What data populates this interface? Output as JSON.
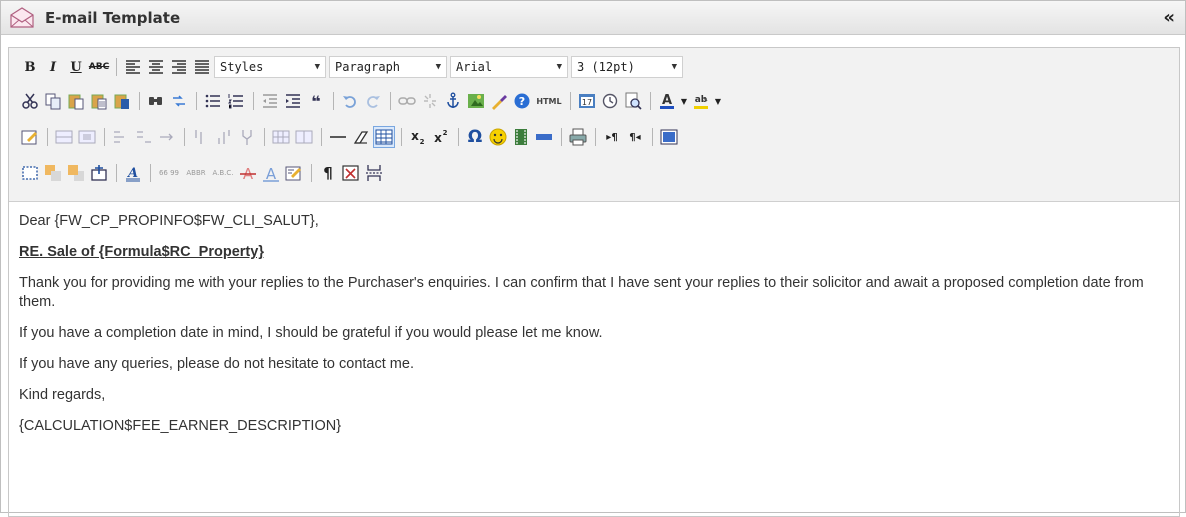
{
  "window": {
    "title": "E-mail Template",
    "collapse_label": "«",
    "icon": "envelope-icon"
  },
  "toolbar": {
    "bold": "B",
    "italic": "I",
    "underline": "U",
    "strike": "ABC",
    "styles": {
      "value": "Styles",
      "options": [
        "Styles"
      ]
    },
    "paragraph": {
      "value": "Paragraph",
      "options": [
        "Paragraph"
      ]
    },
    "font": {
      "value": "Arial",
      "options": [
        "Arial"
      ]
    },
    "size": {
      "value": "3 (12pt)",
      "options": [
        "3 (12pt)"
      ]
    },
    "html_label": "HTML",
    "omega": "Ω",
    "pilcrow": "¶",
    "abbr_label": "ABBR",
    "acronym_label": "A.B.C.",
    "cite_label": "66 99",
    "ltr": "▸¶",
    "rtl": "¶◂"
  },
  "colors": {
    "title_bg": "#e8e8e8",
    "toolbar_bg": "#f2f2f2",
    "text": "#333333",
    "accent_blue": "#1f5fb3",
    "accent_red": "#cc2222",
    "accent_green": "#2e8b2e"
  },
  "content": {
    "salutation": "Dear {FW_CP_PROPINFO$FW_CLI_SALUT},",
    "subject": "RE. Sale of {Formula$RC_Property}",
    "para1": "Thank you for providing me with your replies to the Purchaser's enquiries.  I can confirm that I have sent your replies to their solicitor and await a proposed completion date from them.",
    "para2": "If you have a completion date in mind, I should be grateful if you would please let me know.",
    "para3": "If you have any queries, please do not hesitate to contact me.",
    "closing": "Kind regards,",
    "signature": "{CALCULATION$FEE_EARNER_DESCRIPTION}"
  }
}
